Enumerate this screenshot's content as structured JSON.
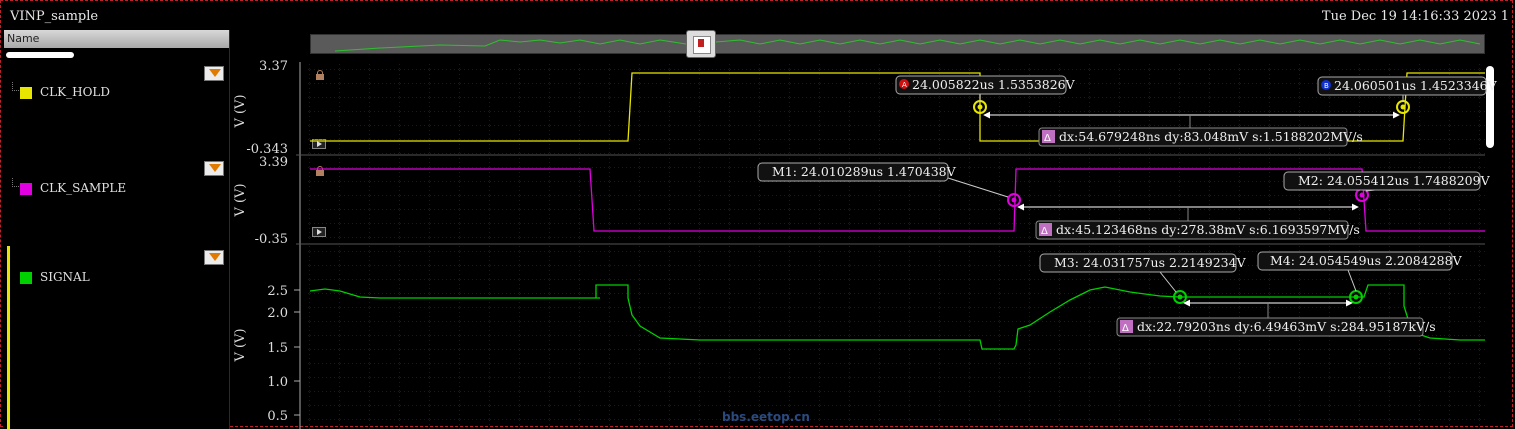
{
  "window": {
    "title": "VINP_sample",
    "timestamp": "Tue Dec 19 14:16:33 2023  1"
  },
  "panel": {
    "header": "Name",
    "signals": [
      {
        "name": "CLK_HOLD",
        "color": "#e6e600"
      },
      {
        "name": "CLK_SAMPLE",
        "color": "#e000e0"
      },
      {
        "name": "SIGNAL",
        "color": "#00d000"
      }
    ]
  },
  "watermark": "bbs.eetop.cn",
  "chart_data": [
    {
      "type": "line",
      "series": [
        {
          "name": "CLK_HOLD",
          "color": "#e6e600"
        }
      ],
      "ylabel": "V (V)",
      "ytick_labels": [
        "3.37",
        "-0.343"
      ],
      "ylim": [
        -0.343,
        3.37
      ],
      "cursors": [
        {
          "id": "A",
          "label": "24.005822us 1.5353826V",
          "x_us": 24.005822,
          "y_v": 1.5353826
        },
        {
          "id": "B",
          "label": "24.060501us 1.4523346V",
          "x_us": 24.060501,
          "y_v": 1.4523346
        }
      ],
      "delta": "dx:54.679248ns dy:83.048mV s:1.5188202MV/s"
    },
    {
      "type": "line",
      "series": [
        {
          "name": "CLK_SAMPLE",
          "color": "#e000e0"
        }
      ],
      "ylabel": "V (V)",
      "ytick_labels": [
        "3.39",
        "-0.35"
      ],
      "ylim": [
        -0.35,
        3.39
      ],
      "markers": [
        {
          "id": "M1",
          "label": "M1: 24.010289us 1.470438V",
          "x_us": 24.010289,
          "y_v": 1.470438
        },
        {
          "id": "M2",
          "label": "M2: 24.055412us 1.7488209V",
          "x_us": 24.055412,
          "y_v": 1.7488209
        }
      ],
      "delta": "dx:45.123468ns dy:278.38mV s:6.1693597MV/s"
    },
    {
      "type": "line",
      "series": [
        {
          "name": "SIGNAL",
          "color": "#00d000"
        }
      ],
      "ylabel": "V (V)",
      "ytick_labels": [
        "2.5",
        "2.0",
        "1.5",
        "1.0",
        "0.5"
      ],
      "yticks": [
        2.5,
        2.0,
        1.5,
        1.0,
        0.5
      ],
      "markers": [
        {
          "id": "M3",
          "label": "M3: 24.031757us 2.2149234V",
          "x_us": 24.031757,
          "y_v": 2.2149234
        },
        {
          "id": "M4",
          "label": "M4: 24.054549us 2.2084288V",
          "x_us": 24.054549,
          "y_v": 2.2084288
        }
      ],
      "delta": "dx:22.79203ns dy:6.49463mV s:284.95187kV/s"
    }
  ]
}
